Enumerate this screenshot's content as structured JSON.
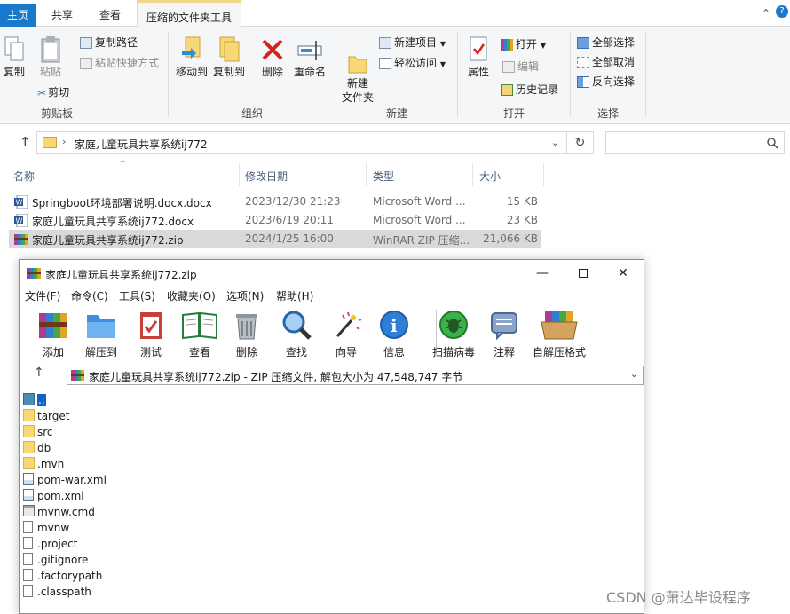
{
  "explorer": {
    "tabs": {
      "home": "主页",
      "share": "共享",
      "view": "查看",
      "zip_tools": "压缩的文件夹工具"
    },
    "ribbon": {
      "clipboard": {
        "label": "剪贴板",
        "copy": "复制",
        "paste": "粘贴",
        "copy_path": "复制路径",
        "paste_shortcut": "粘贴快捷方式",
        "cut": "剪切"
      },
      "organize": {
        "label": "组织",
        "move_to": "移动到",
        "copy_to": "复制到",
        "delete": "删除",
        "rename": "重命名"
      },
      "new": {
        "label": "新建",
        "new_folder": "新建\n文件夹",
        "new_item": "新建项目",
        "easy_access": "轻松访问"
      },
      "open": {
        "label": "打开",
        "properties": "属性",
        "open": "打开",
        "edit": "编辑",
        "history": "历史记录"
      },
      "select": {
        "label": "选择",
        "select_all": "全部选择",
        "select_none": "全部取消",
        "invert": "反向选择"
      }
    },
    "address": {
      "path": "家庭儿童玩具共享系统ij772"
    },
    "columns": {
      "name": "名称",
      "date": "修改日期",
      "type": "类型",
      "size": "大小"
    },
    "files": [
      {
        "name": "Springboot环境部署说明.docx.docx",
        "date": "2023/12/30 21:23",
        "type": "Microsoft Word ...",
        "size": "15 KB",
        "icon": "word-doc-icon"
      },
      {
        "name": "家庭儿童玩具共享系统ij772.docx",
        "date": "2023/6/19 20:11",
        "type": "Microsoft Word ...",
        "size": "23 KB",
        "icon": "word-doc-icon"
      },
      {
        "name": "家庭儿童玩具共享系统ij772.zip",
        "date": "2024/1/25 16:00",
        "type": "WinRAR ZIP 压缩...",
        "size": "21,066 KB",
        "icon": "winrar-archive-icon"
      }
    ]
  },
  "winrar": {
    "title": "家庭儿童玩具共享系统ij772.zip",
    "menu": [
      "文件(F)",
      "命令(C)",
      "工具(S)",
      "收藏夹(O)",
      "选项(N)",
      "帮助(H)"
    ],
    "toolbar": [
      "添加",
      "解压到",
      "测试",
      "查看",
      "删除",
      "查找",
      "向导",
      "信息",
      "扫描病毒",
      "注释",
      "自解压格式"
    ],
    "path_text": "家庭儿童玩具共享系统ij772.zip - ZIP 压缩文件, 解包大小为 47,548,747 字节",
    "items": [
      {
        "name": "..",
        "icon": "parent-folder-icon"
      },
      {
        "name": "target",
        "icon": "folder-icon"
      },
      {
        "name": "src",
        "icon": "folder-icon"
      },
      {
        "name": "db",
        "icon": "folder-icon"
      },
      {
        "name": ".mvn",
        "icon": "folder-icon"
      },
      {
        "name": "pom-war.xml",
        "icon": "xml-file-icon"
      },
      {
        "name": "pom.xml",
        "icon": "xml-file-icon"
      },
      {
        "name": "mvnw.cmd",
        "icon": "cmd-file-icon"
      },
      {
        "name": "mvnw",
        "icon": "file-icon"
      },
      {
        "name": ".project",
        "icon": "file-icon"
      },
      {
        "name": ".gitignore",
        "icon": "file-icon"
      },
      {
        "name": ".factorypath",
        "icon": "file-icon"
      },
      {
        "name": ".classpath",
        "icon": "file-icon"
      }
    ]
  },
  "watermark": "CSDN @萧达毕设程序",
  "colors": {
    "accent_blue": "#1979ca",
    "selection_gray": "#d9d9d9",
    "folder_yellow": "#f8d775",
    "rar_selection": "#0f65c2"
  }
}
